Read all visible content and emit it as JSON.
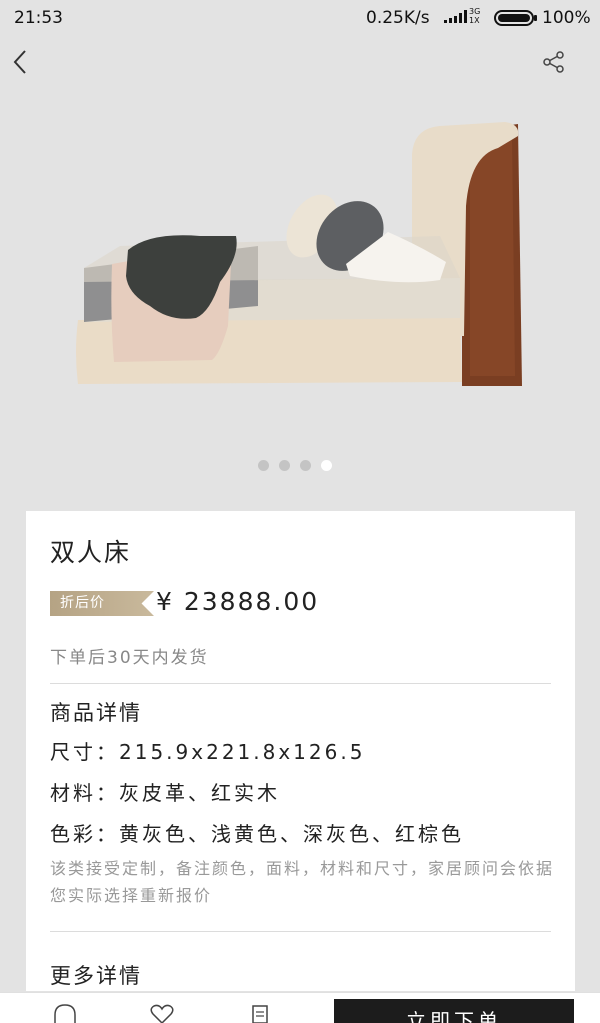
{
  "status": {
    "time": "21:53",
    "speed": "0.25K/s",
    "network_top": "3G",
    "network_bottom": "1X",
    "battery": "100%"
  },
  "icons": {
    "back": "chevron-left-icon",
    "share": "share-icon",
    "service": "headset-icon",
    "favorite": "heart-icon",
    "list": "document-icon"
  },
  "carousel": {
    "count": 4,
    "active_index": 4
  },
  "product": {
    "name": "双人床",
    "discount_tag": "折后价",
    "price": "¥ 23888.00",
    "shipping": "下单后30天内发货"
  },
  "details": {
    "heading": "商品详情",
    "size": "尺寸：215.9x221.8x126.5",
    "material": "材料：灰皮革、红实木",
    "colors": "色彩：黄灰色、浅黄色、深灰色、红棕色",
    "note": "该类接受定制，备注颜色，面料，材料和尺寸，家居顾问会依据您实际选择重新报价"
  },
  "more": {
    "heading": "更多详情"
  },
  "actions": {
    "buy_label": "立即下单"
  },
  "colors": {
    "card_bg": "#ffffff",
    "page_bg": "#e3e3e3",
    "tag_gold": "#b5a384",
    "buy_bg": "#1c1c1c"
  }
}
